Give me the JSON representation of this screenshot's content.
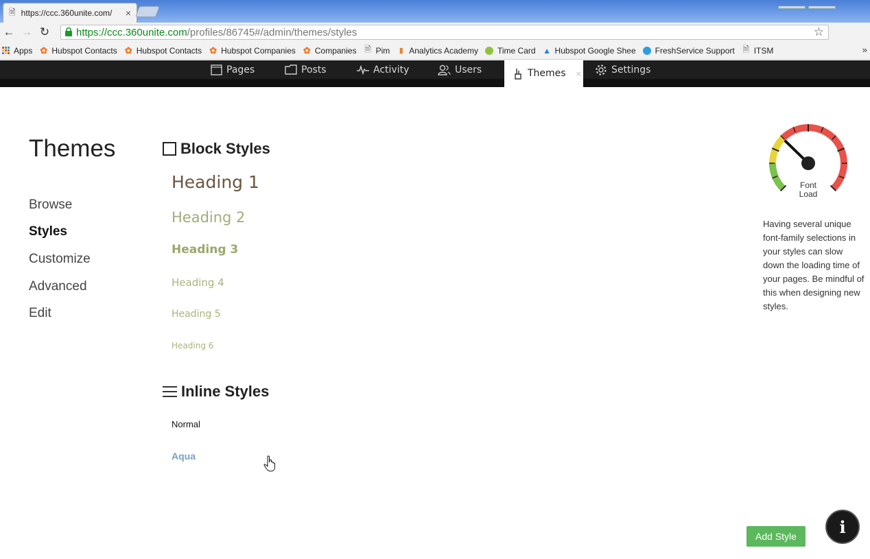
{
  "browser": {
    "tab_title": "https://ccc.360unite.com/",
    "tab_close": "×",
    "url_scheme": "https://",
    "url_host": "ccc.360unite.com",
    "url_path": "/profiles/86745#/admin/themes/styles",
    "bookmarks": [
      {
        "label": "Apps",
        "icon": "apps-grid-icon"
      },
      {
        "label": "Hubspot Contacts",
        "icon": "hubspot-icon"
      },
      {
        "label": "Hubspot Contacts",
        "icon": "hubspot-icon"
      },
      {
        "label": "Hubspot Companies",
        "icon": "hubspot-icon"
      },
      {
        "label": "Companies",
        "icon": "hubspot-icon"
      },
      {
        "label": "Pim",
        "icon": "page-icon"
      },
      {
        "label": "Analytics Academy",
        "icon": "analytics-icon"
      },
      {
        "label": "Time Card",
        "icon": "timecard-icon"
      },
      {
        "label": "Hubspot Google Shee",
        "icon": "drive-icon"
      },
      {
        "label": "FreshService Support",
        "icon": "freshservice-icon"
      },
      {
        "label": "ITSM",
        "icon": "page-icon"
      }
    ],
    "bookmarks_more": "»"
  },
  "appnav": {
    "pages": "Pages",
    "posts": "Posts",
    "activity": "Activity",
    "users": "Users",
    "themes": "Themes",
    "themes_close": "×",
    "settings": "Settings"
  },
  "page": {
    "title": "Themes",
    "sidebar": [
      {
        "label": "Browse",
        "active": false
      },
      {
        "label": "Styles",
        "active": true
      },
      {
        "label": "Customize",
        "active": false
      },
      {
        "label": "Advanced",
        "active": false
      },
      {
        "label": "Edit",
        "active": false
      }
    ]
  },
  "block_styles": {
    "title": "Block Styles",
    "headings": [
      "Heading 1",
      "Heading 2",
      "Heading 3",
      "Heading 4",
      "Heading 5",
      "Heading 6"
    ]
  },
  "inline_styles": {
    "title": "Inline Styles",
    "items": [
      "Normal",
      "Aqua"
    ]
  },
  "gauge": {
    "label_line1": "Font",
    "label_line2": "Load",
    "level": 0.33,
    "description": "Having several unique font-family selections in your styles can slow down the loading time of your pages. Be mindful of this when designing new styles."
  },
  "actions": {
    "add_style": "Add Style",
    "info": "i"
  },
  "colors": {
    "add_style_bg": "#5cb85c",
    "url_host": "#0a8a1a",
    "gauge_green": "#7cc24e",
    "gauge_yellow": "#e7d53a",
    "gauge_red": "#e8524b"
  }
}
